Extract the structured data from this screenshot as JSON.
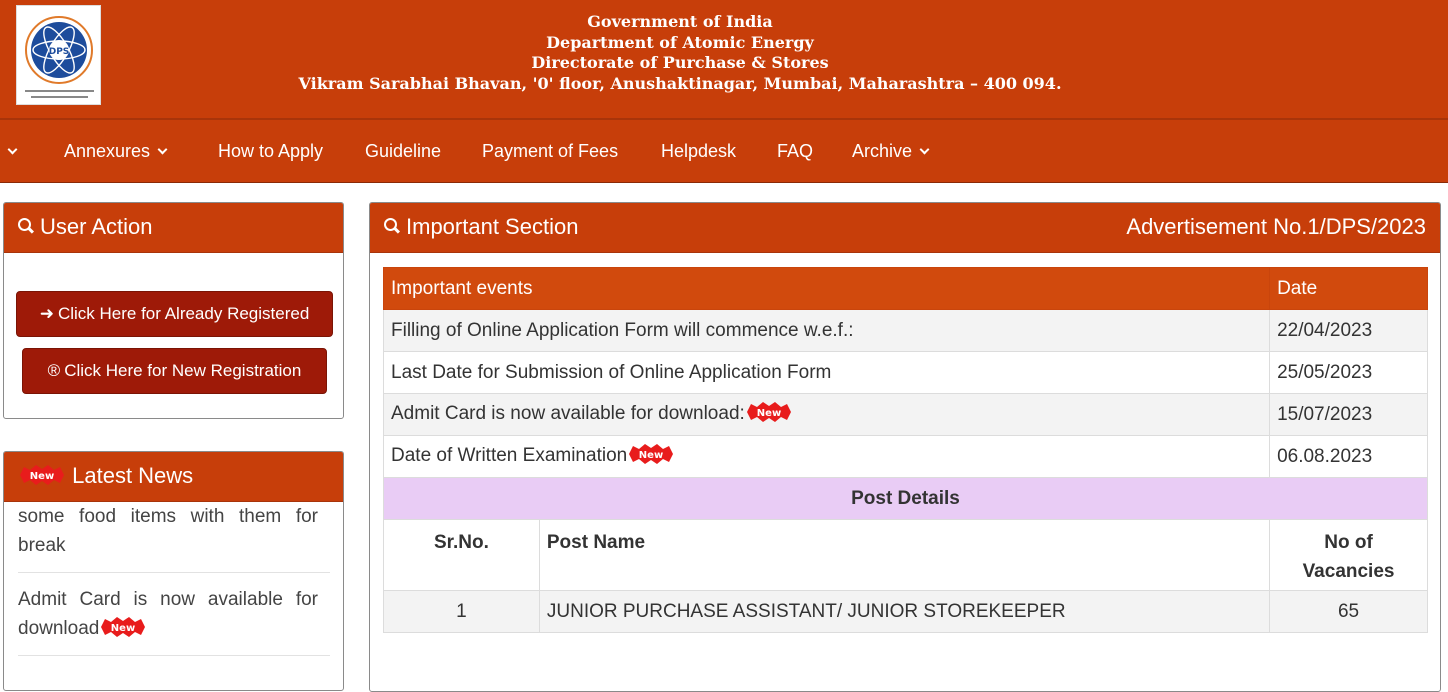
{
  "header": {
    "logo_text": "DPS",
    "lines": [
      "Government of India",
      "Department of Atomic Energy",
      "Directorate of Purchase & Stores",
      "Vikram Sarabhai Bhavan, '0' floor, Anushaktinagar, Mumbai, Maharashtra – 400 094."
    ]
  },
  "nav": {
    "items": [
      {
        "label": "",
        "has_dropdown": true
      },
      {
        "label": "Annexures",
        "has_dropdown": true
      },
      {
        "label": "How to Apply",
        "has_dropdown": false
      },
      {
        "label": "Guideline",
        "has_dropdown": false
      },
      {
        "label": "Payment of Fees",
        "has_dropdown": false
      },
      {
        "label": "Helpdesk",
        "has_dropdown": false
      },
      {
        "label": "FAQ",
        "has_dropdown": false
      },
      {
        "label": "Archive",
        "has_dropdown": true
      }
    ]
  },
  "user_action": {
    "title": "User Action",
    "login_button": "Click Here for Already Registered",
    "register_button": "Click Here for New Registration"
  },
  "latest_news": {
    "title": "Latest News",
    "badge_text": "New",
    "items": [
      "some food items with them for break",
      "Admit Card is now available for download"
    ]
  },
  "important": {
    "title": "Important Section",
    "advertisement": "Advertisement No.1/DPS/2023",
    "events_header": "Important events",
    "date_header": "Date",
    "badge_text": "New",
    "events": [
      {
        "event": "Filling of Online Application Form will commence w.e.f.:",
        "date": "22/04/2023"
      },
      {
        "event": "Last Date for Submission of Online Application Form",
        "date": "25/05/2023"
      },
      {
        "event": "Admit Card is now available for download:",
        "date": "15/07/2023"
      },
      {
        "event": "Date of Written Examination",
        "date": "06.08.2023"
      }
    ],
    "post_details_title": "Post Details",
    "post_columns": [
      "Sr.No.",
      "Post Name",
      "No of Vacancies"
    ],
    "posts": [
      {
        "sr": "1",
        "name": "JUNIOR PURCHASE ASSISTANT/ JUNIOR STOREKEEPER",
        "vacancies": "65"
      }
    ]
  },
  "colors": {
    "brand": "#c73e0a",
    "button": "#9e1a08",
    "table_head": "#d14a0d",
    "post_details_bg": "#e9ccf5"
  }
}
